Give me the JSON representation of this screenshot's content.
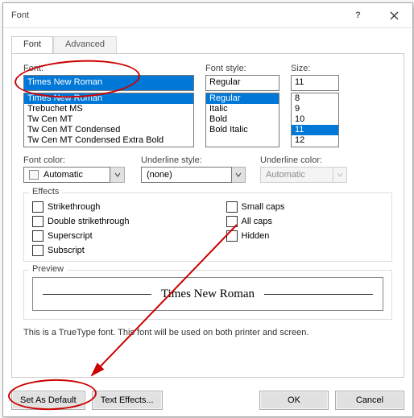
{
  "title": "Font",
  "tabs": {
    "font": "  Font  ",
    "advanced": "Advanced"
  },
  "fontSection": {
    "label": "Font:",
    "input": "Times New Roman",
    "items": [
      "Times New Roman",
      "Trebuchet MS",
      "Tw Cen MT",
      "Tw Cen MT Condensed",
      "Tw Cen MT Condensed Extra Bold"
    ]
  },
  "styleSection": {
    "label": "Font style:",
    "input": "Regular",
    "items": [
      "Regular",
      "Italic",
      "Bold",
      "Bold Italic"
    ]
  },
  "sizeSection": {
    "label": "Size:",
    "input": "11",
    "items": [
      "8",
      "9",
      "10",
      "11",
      "12"
    ]
  },
  "color": {
    "label": "Font color:",
    "value": "Automatic"
  },
  "underline": {
    "label": "Underline style:",
    "value": "(none)"
  },
  "ucolor": {
    "label": "Underline color:",
    "value": "Automatic"
  },
  "effects": {
    "label": "Effects",
    "left": [
      "Strikethrough",
      "Double strikethrough",
      "Superscript",
      "Subscript"
    ],
    "right": [
      "Small caps",
      "All caps",
      "Hidden"
    ]
  },
  "preview": {
    "label": "Preview",
    "text": "Times New Roman"
  },
  "note": "This is a TrueType font. This font will be used on both printer and screen.",
  "buttons": {
    "setDefault": "Set As Default",
    "textEffects": "Text Effects...",
    "ok": "OK",
    "cancel": "Cancel"
  }
}
